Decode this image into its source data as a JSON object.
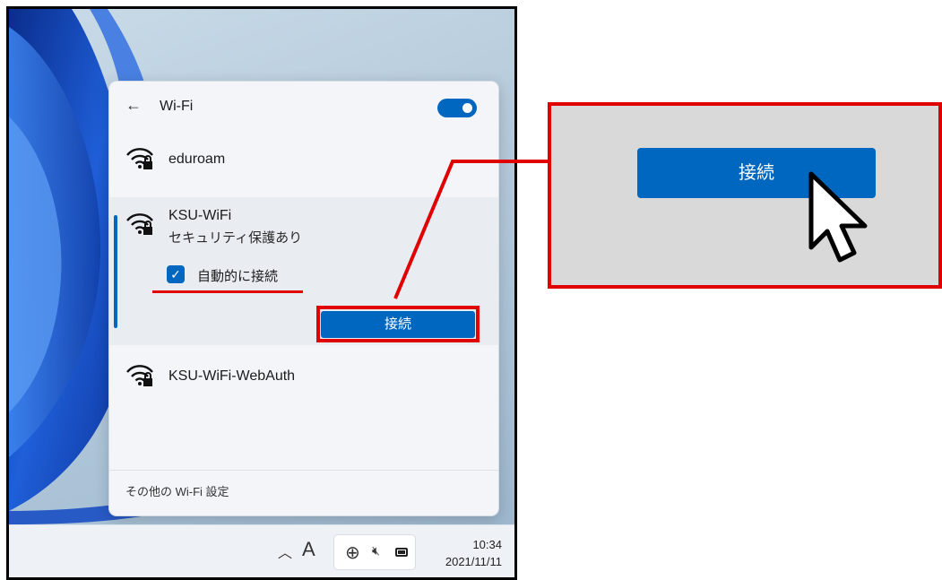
{
  "flyout": {
    "back_icon": "back-arrow-icon",
    "title": "Wi-Fi",
    "toggle_state": "on",
    "networks": [
      {
        "ssid": "eduroam",
        "icon": "wifi-lock-icon"
      },
      {
        "ssid": "KSU-WiFi",
        "status": "セキュリティ保護あり",
        "icon": "wifi-lock-icon",
        "auto_connect_label": "自動的に接続",
        "auto_connect_checked": true,
        "connect_label": "接続"
      },
      {
        "ssid": "KSU-WiFi-WebAuth",
        "icon": "wifi-lock-icon"
      }
    ],
    "footer_link": "その他の Wi-Fi 設定"
  },
  "taskbar": {
    "chevron": "^",
    "ime": "A",
    "time": "10:34",
    "date": "2021/11/11"
  },
  "callout": {
    "connect_label": "接続"
  },
  "colors": {
    "accent": "#0067c0",
    "highlight": "#e00000",
    "callout_bg": "#d9d9d9"
  }
}
